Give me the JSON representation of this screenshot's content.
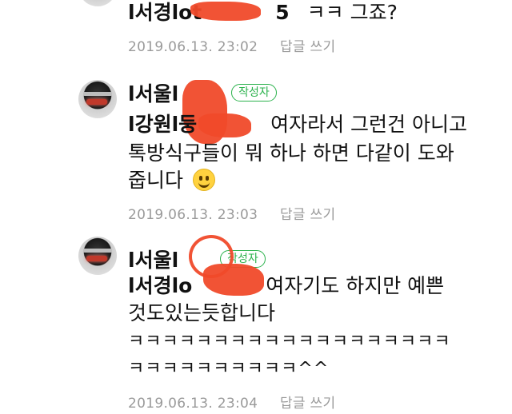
{
  "comments": [
    {
      "nick": "l서경lot",
      "nick_suffix": "5",
      "text": "ㅋㅋ 그죠?",
      "date": "2019.06.13. 23:02",
      "reply_label": "답글 쓰기"
    },
    {
      "nick": "l서울l",
      "badge": "작성자",
      "mention": "l강원l둥",
      "text_line1": "여자라서 그런건 아니고",
      "text_line2": "톡방식구들이 뭐 하나 하면 다같이 도와",
      "text_line3": "줍니다",
      "emoji": "smiling-face",
      "date": "2019.06.13. 23:03",
      "reply_label": "답글 쓰기"
    },
    {
      "nick": "l서울l",
      "badge": "작성자",
      "mention": "l서경lo",
      "text_line1": "여자기도 하지만 예쁜",
      "text_line2": "것도있는듯합니다",
      "text_line3": "ㅋㅋㅋㅋㅋㅋㅋㅋㅋㅋㅋㅋㅋㅋㅋㅋㅋㅋㅋ",
      "text_line4": "ㅋㅋㅋㅋㅋㅋㅋㅋㅋㅋ^^",
      "date": "2019.06.13. 23:04",
      "reply_label": "답글 쓰기"
    }
  ],
  "colors": {
    "badge": "#2bb24c",
    "meta": "#9a9a9a",
    "redaction": "#f04a2a"
  }
}
